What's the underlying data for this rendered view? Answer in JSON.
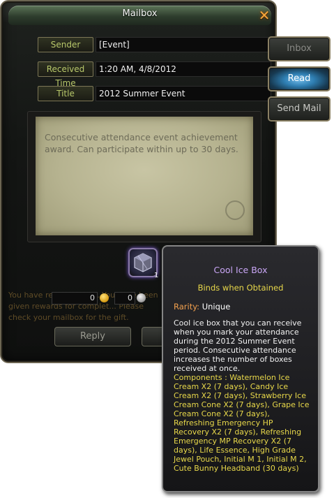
{
  "window": {
    "title": "Mailbox"
  },
  "fields": {
    "sender_label": "Sender",
    "sender_value": "[Event]",
    "received_label": "Received Time",
    "received_value": "1:20 AM, 4/8/2012",
    "title_label": "Title",
    "title_value": "2012 Summer Event"
  },
  "letter": {
    "body": "Consecutive attendance event achievement award. Can participate within up to 30 days."
  },
  "attachment": {
    "count": "1",
    "icon": "ice-box-icon"
  },
  "currency": {
    "gold": "0",
    "silver": "0"
  },
  "background_message": "You have received mail. You have been given rewards for complet... Please check your mailbox for the gift.",
  "buttons": {
    "reply": "Reply",
    "second": ""
  },
  "tabs": {
    "inbox": "Inbox",
    "read": "Read",
    "send": "Send Mail"
  },
  "tooltip": {
    "name": "Cool Ice Box",
    "bind": "Binds when Obtained",
    "rarity_label": "Rarity:",
    "rarity_value": "Unique",
    "description": "Cool ice box that you can receive when you mark your attendance during the 2012 Summer Event period. Consecutive attendance increases the number of boxes received at once.",
    "components": "Components : Watermelon Ice Cream X2 (7 days), Candy Ice Cream X2 (7 days), Strawberry Ice Cream Cone X2 (7 days), Grape Ice Cream Cone X2 (7 days), Refreshing Emergency HP Recovery X2 (7 days), Refreshing Emergency MP Recovery X2 (7 days), Life Essence, High Grade Jewel Pouch, Initial M 1, Initial M 2, Cute Bunny Headband (30 days)"
  },
  "colors": {
    "label_text": "#b8c86a",
    "item_name": "#c9a6f5",
    "bind_text": "#e8d84a",
    "rarity_label": "#f2a04e",
    "read_tab": "#2f7fb3",
    "close_icon": "#f6a63a"
  }
}
